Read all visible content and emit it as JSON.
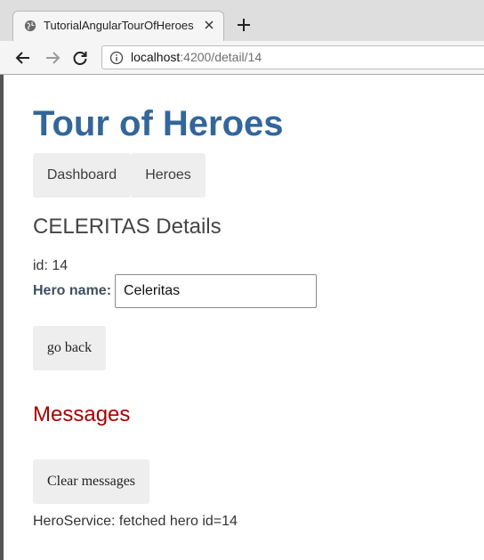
{
  "browser": {
    "tab_title": "TutorialAngularTourOfHeroes",
    "url_host": "localhost",
    "url_path": ":4200/detail/14"
  },
  "page": {
    "app_title": "Tour of Heroes",
    "nav": [
      {
        "label": "Dashboard"
      },
      {
        "label": "Heroes"
      }
    ],
    "details_title": "CELERITAS Details",
    "id_label": "id:",
    "id_value": "14",
    "name_label": "Hero name:",
    "name_value": "Celeritas",
    "go_back_label": "go back",
    "messages_title": "Messages",
    "clear_label": "Clear messages",
    "messages": [
      "HeroService: fetched hero id=14"
    ]
  },
  "colors": {
    "title": "#336699",
    "messages_title": "#a80000",
    "button_bg": "#eeeeee"
  }
}
